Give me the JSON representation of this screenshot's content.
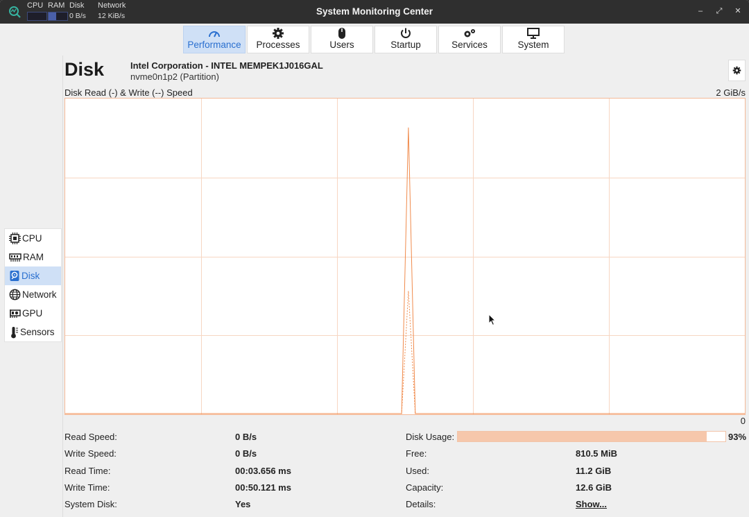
{
  "titlebar": {
    "title": "System Monitoring Center",
    "mini_cpu_label": "CPU",
    "mini_ram_label": "RAM",
    "mini_disk_label": "Disk",
    "mini_disk_value": "0 B/s",
    "mini_network_label": "Network",
    "mini_network_value": "12 KiB/s",
    "minimize_label": "–",
    "maximize_label": "⤢",
    "close_label": "✕"
  },
  "tabs": [
    {
      "label": "Performance",
      "icon": "gauge-icon",
      "active": true
    },
    {
      "label": "Processes",
      "icon": "gear-icon",
      "active": false
    },
    {
      "label": "Users",
      "icon": "mouse-icon",
      "active": false
    },
    {
      "label": "Startup",
      "icon": "power-icon",
      "active": false
    },
    {
      "label": "Services",
      "icon": "gears-icon",
      "active": false
    },
    {
      "label": "System",
      "icon": "monitor-icon",
      "active": false
    }
  ],
  "sidebar": [
    {
      "label": "CPU",
      "icon": "cpu-icon",
      "active": false
    },
    {
      "label": "RAM",
      "icon": "ram-icon",
      "active": false
    },
    {
      "label": "Disk",
      "icon": "disk-icon",
      "active": true
    },
    {
      "label": "Network",
      "icon": "globe-icon",
      "active": false
    },
    {
      "label": "GPU",
      "icon": "gpu-icon",
      "active": false
    },
    {
      "label": "Sensors",
      "icon": "thermometer-icon",
      "active": false
    }
  ],
  "disk": {
    "title": "Disk",
    "vendor_model": "Intel Corporation - INTEL MEMPEK1J016GAL",
    "partition": "nvme0n1p2 (Partition)"
  },
  "chart": {
    "label": "Disk Read (-) & Write (--) Speed",
    "max_label": "2 GiB/s",
    "min_label": "0"
  },
  "chart_data": {
    "type": "line",
    "title": "Disk Read (-) & Write (--) Speed",
    "ylim_label": [
      "0",
      "2 GiB/s"
    ],
    "series": [
      {
        "name": "Read",
        "style": "solid",
        "values": [
          0,
          0,
          0,
          0,
          0,
          0,
          0,
          0,
          0,
          0,
          0,
          0,
          0,
          0,
          0,
          0,
          0,
          0,
          0,
          0,
          0,
          0,
          0,
          0,
          0,
          0,
          0,
          0,
          0,
          0,
          0,
          0,
          0,
          0,
          0,
          0,
          0,
          0,
          0,
          0,
          0,
          0,
          0,
          0,
          0,
          0,
          0,
          0,
          0,
          0,
          0.91,
          0,
          0,
          0,
          0,
          0,
          0,
          0,
          0,
          0,
          0,
          0,
          0,
          0,
          0,
          0,
          0,
          0,
          0,
          0,
          0,
          0,
          0,
          0,
          0,
          0,
          0,
          0,
          0,
          0,
          0,
          0,
          0,
          0,
          0,
          0,
          0,
          0,
          0,
          0,
          0,
          0,
          0,
          0,
          0,
          0,
          0,
          0,
          0,
          0
        ]
      },
      {
        "name": "Write",
        "style": "dashed",
        "values": [
          0,
          0,
          0,
          0,
          0,
          0,
          0,
          0,
          0,
          0,
          0,
          0,
          0,
          0,
          0,
          0,
          0,
          0,
          0,
          0,
          0,
          0,
          0,
          0,
          0,
          0,
          0,
          0,
          0,
          0,
          0,
          0,
          0,
          0,
          0,
          0,
          0,
          0,
          0,
          0,
          0,
          0,
          0,
          0,
          0,
          0,
          0,
          0,
          0,
          0,
          0.39,
          0,
          0,
          0,
          0,
          0,
          0,
          0,
          0,
          0,
          0,
          0,
          0,
          0,
          0,
          0,
          0,
          0,
          0,
          0,
          0,
          0,
          0,
          0,
          0,
          0,
          0,
          0,
          0,
          0,
          0,
          0,
          0,
          0,
          0,
          0,
          0,
          0,
          0,
          0,
          0,
          0,
          0,
          0,
          0,
          0,
          0,
          0,
          0,
          0
        ]
      }
    ],
    "grid": true,
    "color": "#f08a4b"
  },
  "stats": {
    "read_speed_label": "Read Speed:",
    "read_speed": "0 B/s",
    "write_speed_label": "Write Speed:",
    "write_speed": "0 B/s",
    "read_time_label": "Read Time:",
    "read_time": "00:03.656 ms",
    "write_time_label": "Write Time:",
    "write_time": "00:50.121 ms",
    "system_disk_label": "System Disk:",
    "system_disk": "Yes",
    "disk_usage_label": "Disk Usage:",
    "disk_usage_percent": "93%",
    "disk_usage_fraction": 0.93,
    "free_label": "Free:",
    "free": "810.5 MiB",
    "used_label": "Used:",
    "used": "11.2 GiB",
    "capacity_label": "Capacity:",
    "capacity": "12.6 GiB",
    "details_label": "Details:",
    "details_link": "Show..."
  },
  "colors": {
    "accent": "#2a6fcf",
    "active_bg": "#cfe0f6",
    "chart_line": "#f08a4b",
    "usage_fill": "#f6c7ab"
  }
}
